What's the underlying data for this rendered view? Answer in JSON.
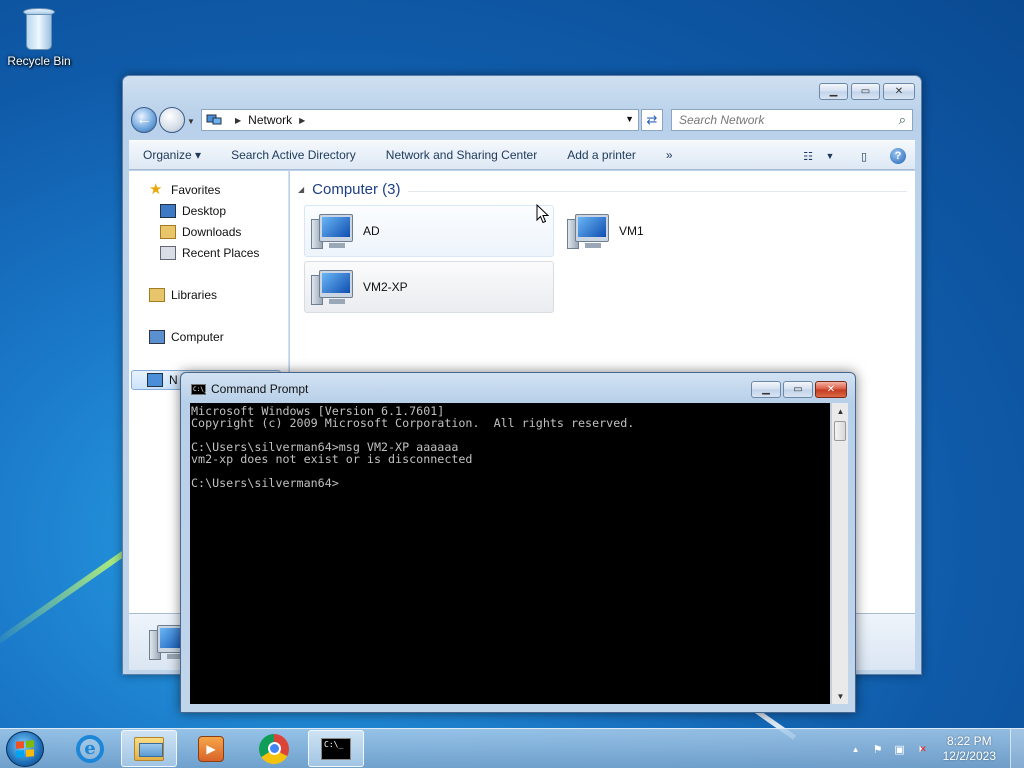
{
  "desktop": {
    "icons": [
      {
        "label": "Recycle Bin",
        "icon": "recycle-bin-icon"
      }
    ]
  },
  "explorer": {
    "address": {
      "location": "Network"
    },
    "search": {
      "placeholder": "Search Network"
    },
    "toolbar": {
      "organize": "Organize",
      "search_ad": "Search Active Directory",
      "network_sharing": "Network and Sharing Center",
      "add_printer": "Add a printer",
      "more": "»"
    },
    "nav": {
      "favorites": "Favorites",
      "desktop": "Desktop",
      "downloads": "Downloads",
      "recent_places": "Recent Places",
      "libraries": "Libraries",
      "computer": "Computer",
      "network": "N"
    },
    "group": {
      "title": "Computer (3)"
    },
    "computers": [
      {
        "name": "AD"
      },
      {
        "name": "VM1"
      },
      {
        "name": "VM2-XP"
      }
    ]
  },
  "cmd": {
    "title": "Command Prompt",
    "icon_text": "C:\\_",
    "lines": [
      "Microsoft Windows [Version 6.1.7601]",
      "Copyright (c) 2009 Microsoft Corporation.  All rights reserved.",
      "",
      "C:\\Users\\silverman64>msg VM2-XP aaaaaa",
      "vm2-xp does not exist or is disconnected",
      "",
      "C:\\Users\\silverman64>"
    ]
  },
  "taskbar": {
    "apps": [
      "internet-explorer-icon",
      "windows-explorer-icon",
      "windows-media-player-icon",
      "chrome-icon",
      "command-prompt-icon"
    ],
    "cmd_icon_text": "C:\\_",
    "clock": {
      "time": "8:22 PM",
      "date": "12/2/2023"
    }
  }
}
